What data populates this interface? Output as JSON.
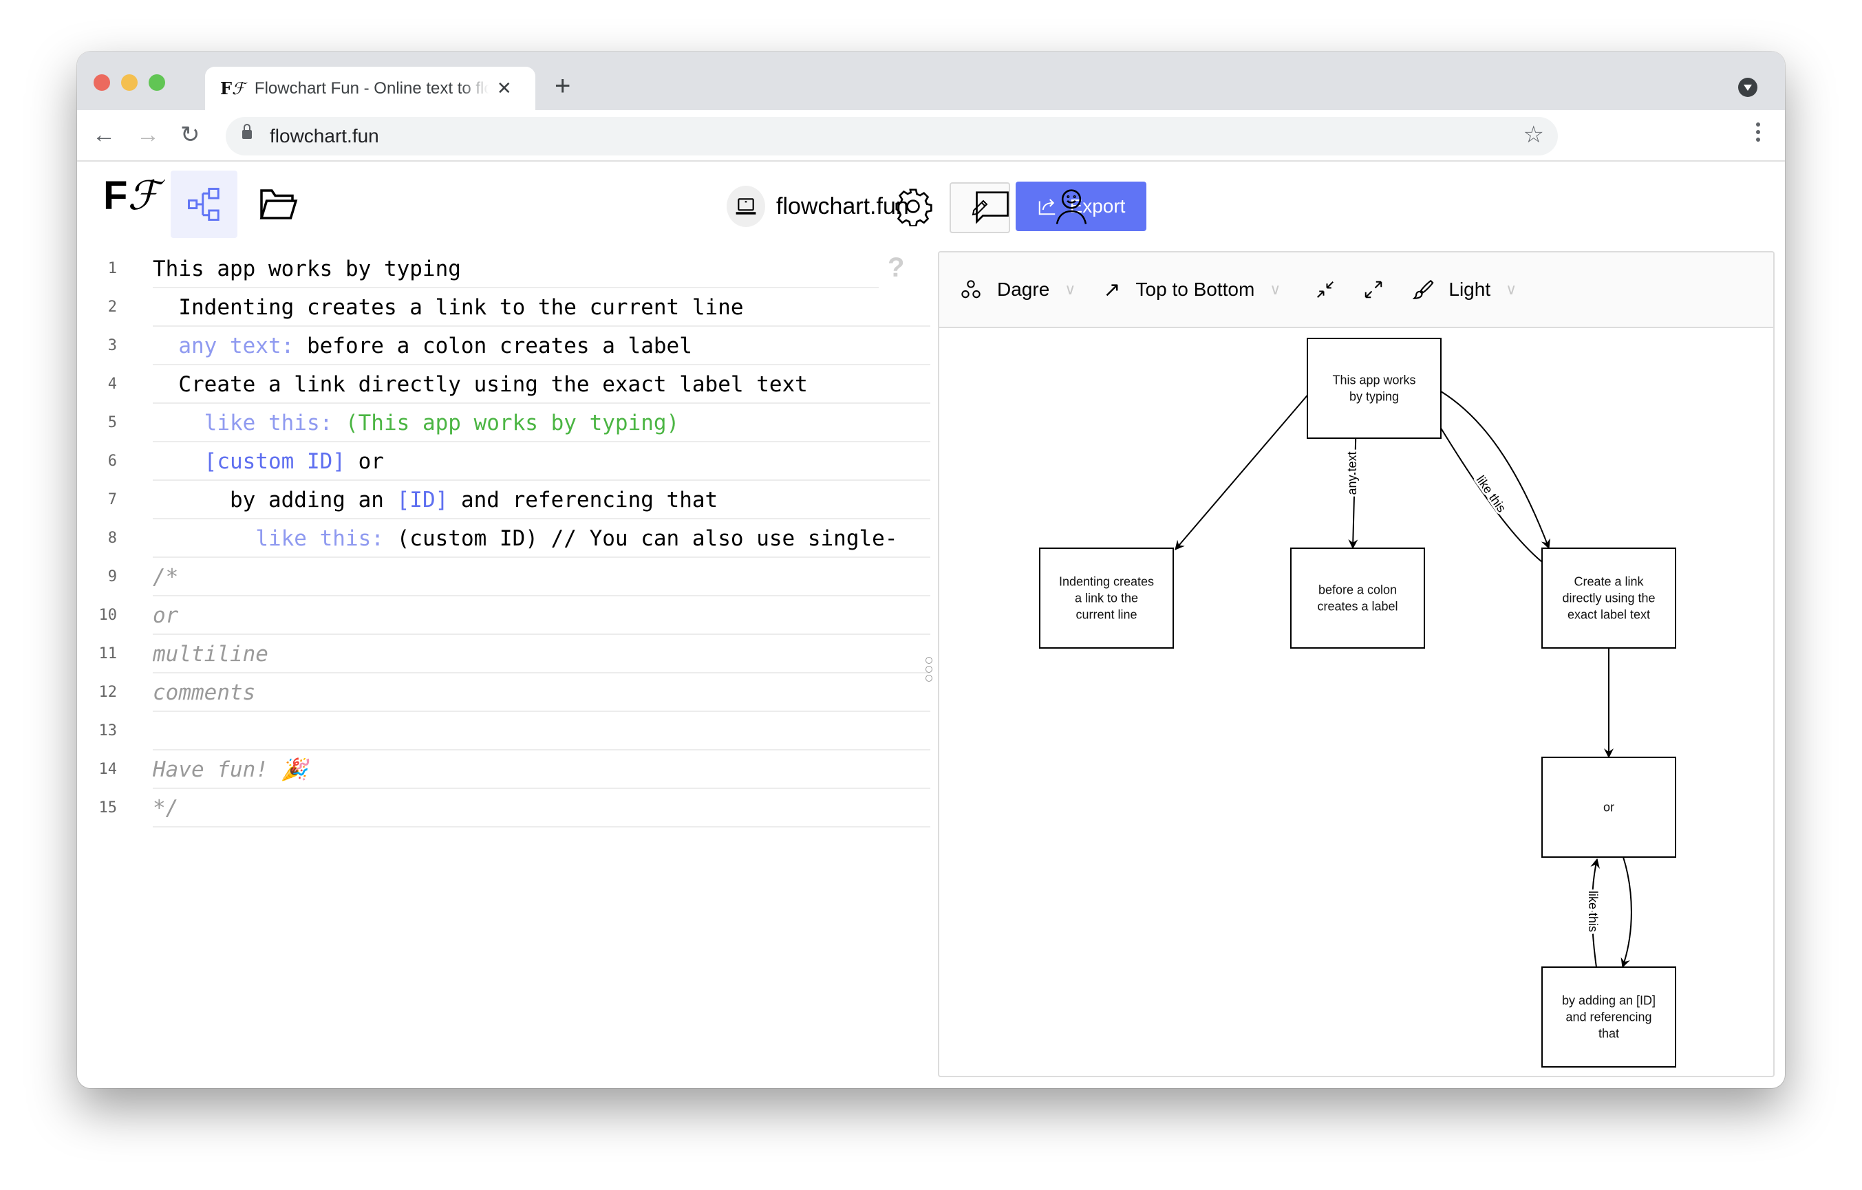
{
  "browser": {
    "tab_title": "Flowchart Fun - Online text to flowchart",
    "tab_favicon": "FF",
    "new_tab_icon": "plus-icon",
    "url": "flowchart.fun",
    "traffic_lights": {
      "close": "#ec6a5e",
      "minimize": "#f4bf4f",
      "maximize": "#61c554"
    }
  },
  "app": {
    "logo": {
      "bold": "F",
      "italic": "F"
    },
    "header_icons": [
      "flowchart-icon",
      "folder-icon"
    ],
    "site_name": "flowchart.fun",
    "edit_icon": "pencil-icon",
    "export_label": "Export",
    "accent_color": "#6074f5",
    "right_icons": [
      "gear-icon",
      "chat-icon",
      "user-icon"
    ]
  },
  "editor": {
    "help_glyph": "?",
    "lines": [
      {
        "n": "1",
        "indent": 0,
        "tokens": [
          {
            "t": "This app works by typing",
            "c": "plain"
          }
        ]
      },
      {
        "n": "2",
        "indent": 1,
        "tokens": [
          {
            "t": "Indenting creates a link to the current line",
            "c": "plain"
          }
        ]
      },
      {
        "n": "3",
        "indent": 1,
        "tokens": [
          {
            "t": "any text: ",
            "c": "label"
          },
          {
            "t": "before a colon creates a label",
            "c": "plain"
          }
        ]
      },
      {
        "n": "4",
        "indent": 1,
        "tokens": [
          {
            "t": "Create a link directly using the exact label text",
            "c": "plain"
          }
        ]
      },
      {
        "n": "5",
        "indent": 2,
        "tokens": [
          {
            "t": "like this: ",
            "c": "label"
          },
          {
            "t": "(This app works by typing)",
            "c": "ref"
          }
        ]
      },
      {
        "n": "6",
        "indent": 2,
        "tokens": [
          {
            "t": "[custom ID]",
            "c": "id"
          },
          {
            "t": " or",
            "c": "plain"
          }
        ]
      },
      {
        "n": "7",
        "indent": 3,
        "tokens": [
          {
            "t": "by adding an ",
            "c": "plain"
          },
          {
            "t": "[ID]",
            "c": "id"
          },
          {
            "t": " and referencing that",
            "c": "plain"
          }
        ]
      },
      {
        "n": "8",
        "indent": 4,
        "tokens": [
          {
            "t": "like this: ",
            "c": "label"
          },
          {
            "t": "(custom ID) // You can also use single-",
            "c": "plain"
          }
        ]
      },
      {
        "n": "9",
        "indent": 0,
        "tokens": [
          {
            "t": "/*",
            "c": "comment"
          }
        ]
      },
      {
        "n": "10",
        "indent": 0,
        "tokens": [
          {
            "t": "or",
            "c": "comment"
          }
        ]
      },
      {
        "n": "11",
        "indent": 0,
        "tokens": [
          {
            "t": "multiline",
            "c": "comment"
          }
        ]
      },
      {
        "n": "12",
        "indent": 0,
        "tokens": [
          {
            "t": "comments",
            "c": "comment"
          }
        ]
      },
      {
        "n": "13",
        "indent": 0,
        "tokens": []
      },
      {
        "n": "14",
        "indent": 0,
        "tokens": [
          {
            "t": "Have fun! 🎉",
            "c": "comment"
          }
        ]
      },
      {
        "n": "15",
        "indent": 0,
        "tokens": [
          {
            "t": "*/",
            "c": "comment"
          }
        ]
      }
    ]
  },
  "canvas_toolbar": {
    "layout": "Dagre",
    "direction": "Top to Bottom",
    "theme": "Light"
  },
  "graph": {
    "nodes": [
      {
        "id": "n1",
        "lines": [
          "This app works",
          "by typing"
        ]
      },
      {
        "id": "n2",
        "lines": [
          "Indenting creates",
          "a link to the",
          "current line"
        ]
      },
      {
        "id": "n3",
        "lines": [
          "before a colon",
          "creates a label"
        ]
      },
      {
        "id": "n4",
        "lines": [
          "Create a link",
          "directly using the",
          "exact label text"
        ]
      },
      {
        "id": "n5",
        "lines": [
          "or"
        ]
      },
      {
        "id": "n6",
        "lines": [
          "by adding an [ID]",
          "and referencing",
          "that"
        ]
      }
    ],
    "edges": [
      {
        "from": "n1",
        "to": "n2",
        "label": ""
      },
      {
        "from": "n1",
        "to": "n3",
        "label": "any text"
      },
      {
        "from": "n1",
        "to": "n4",
        "label": ""
      },
      {
        "from": "n4",
        "to": "n1",
        "label": "like this"
      },
      {
        "from": "n4",
        "to": "n5",
        "label": ""
      },
      {
        "from": "n5",
        "to": "n6",
        "label": ""
      },
      {
        "from": "n6",
        "to": "n5",
        "label": "like this"
      }
    ]
  }
}
